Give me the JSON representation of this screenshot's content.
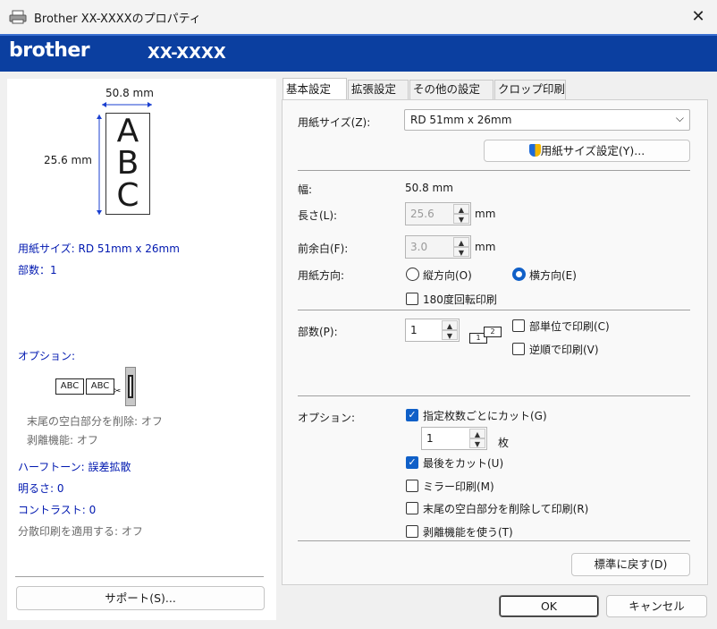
{
  "window": {
    "title": "Brother XX-XXXXのプロパティ"
  },
  "brand": {
    "logo": "brother",
    "model": "XX-XXXX"
  },
  "preview": {
    "width_label": "50.8 mm",
    "height_label": "25.6 mm",
    "letters": [
      "A",
      "B",
      "C"
    ]
  },
  "summary": {
    "paper_size": "用紙サイズ: RD 51mm x 26mm",
    "copies": "部数：1",
    "options_title": "オプション:",
    "option_icon_text": "ABC",
    "trim_tail": "末尾の空白部分を削除: オフ",
    "peel": "剥離機能: オフ",
    "halftone": "ハーフトーン: 誤差拡散",
    "brightness": "明るさ:   0",
    "contrast": "コントラスト:   0",
    "distributed": "分散印刷を適用する: オフ",
    "support_button": "サポート(S)..."
  },
  "tabs": [
    {
      "label": "基本設定",
      "active": true
    },
    {
      "label": "拡張設定",
      "active": false
    },
    {
      "label": "その他の設定",
      "active": false
    },
    {
      "label": "クロップ印刷",
      "active": false
    }
  ],
  "basic": {
    "paper_size_label": "用紙サイズ(Z):",
    "paper_size_value": "RD 51mm x 26mm",
    "paper_size_settings_button": "用紙サイズ設定(Y)...",
    "width_label": "幅:",
    "width_value": "50.8 mm",
    "length_label": "長さ(L):",
    "length_value": "25.6",
    "length_unit": "mm",
    "margin_label": "前余白(F):",
    "margin_value": "3.0",
    "margin_unit": "mm",
    "orientation_label": "用紙方向:",
    "portrait_label": "縦方向(O)",
    "landscape_label": "横方向(E)",
    "rotate_label": "180度回転印刷",
    "copies_label": "部数(P):",
    "copies_value": "1",
    "collate_icon_1": "1",
    "collate_icon_2": "2",
    "collate_label": "部単位で印刷(C)",
    "reverse_label": "逆順で印刷(V)",
    "options_label": "オプション:",
    "cut_every_label": "指定枚数ごとにカット(G)",
    "cut_every_value": "1",
    "cut_every_unit": "枚",
    "cut_last_label": "最後をカット(U)",
    "mirror_label": "ミラー印刷(M)",
    "trim_tail_label": "末尾の空白部分を削除して印刷(R)",
    "peel_label": "剥離機能を使う(T)",
    "restore_button": "標準に戻す(D)"
  },
  "footer": {
    "ok": "OK",
    "cancel": "キャンセル"
  },
  "colors": {
    "brand_bar": "#0b3fa0",
    "accent": "#1060c8",
    "summary_text": "#0018b0"
  }
}
